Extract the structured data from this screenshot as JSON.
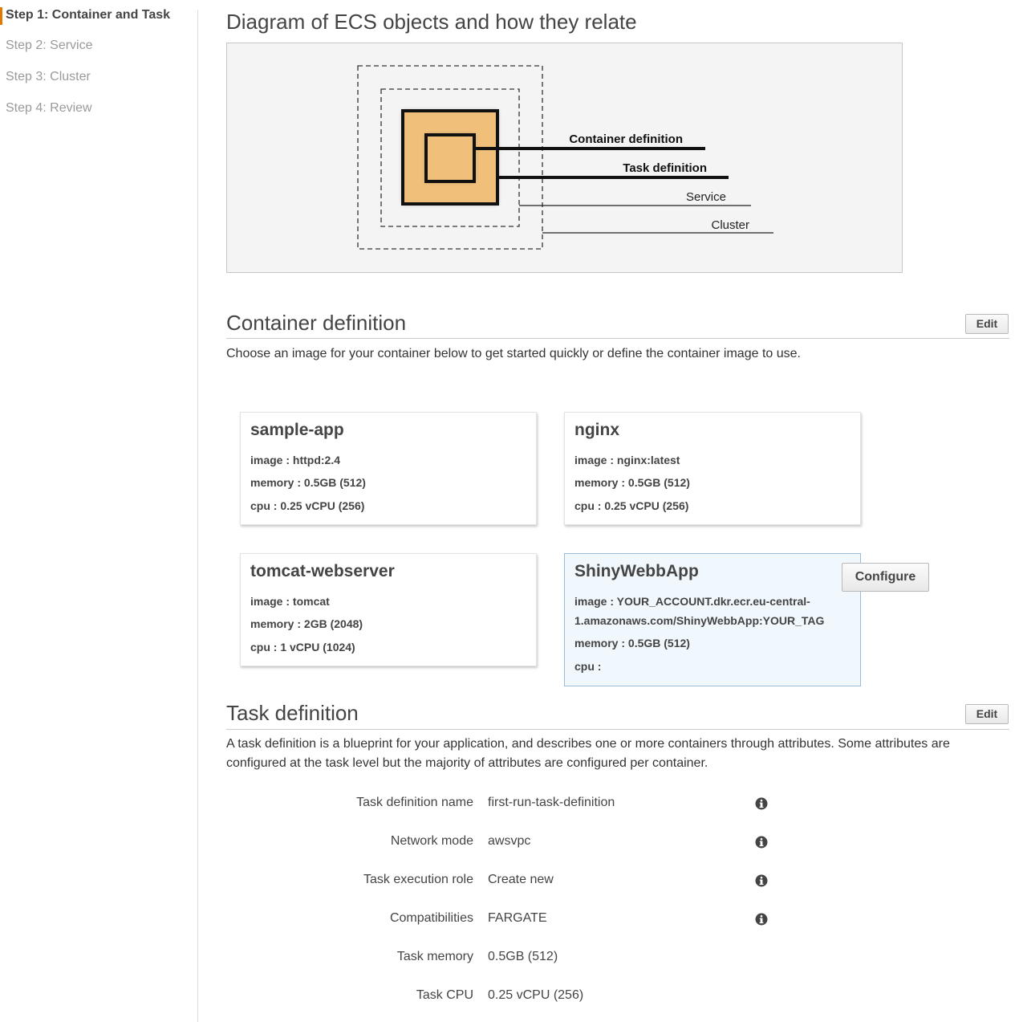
{
  "sidebar": {
    "steps": [
      {
        "label": "Step 1: Container and Task",
        "active": true
      },
      {
        "label": "Step 2: Service",
        "active": false
      },
      {
        "label": "Step 3: Cluster",
        "active": false
      },
      {
        "label": "Step 4: Review",
        "active": false
      }
    ]
  },
  "diagram_section": {
    "title": "Diagram of ECS objects and how they relate",
    "labels": {
      "container_definition": "Container definition",
      "task_definition": "Task definition",
      "service": "Service",
      "cluster": "Cluster"
    },
    "colors": {
      "container_fill": "#f0c07a",
      "background": "#f4f4f4"
    }
  },
  "container_section": {
    "title": "Container definition",
    "edit_label": "Edit",
    "description": "Choose an image for your container below to get started quickly or define the container image to use.",
    "configure_label": "Configure",
    "cards": [
      {
        "name": "sample-app",
        "image": "image : httpd:2.4",
        "memory": "memory :  0.5GB (512)",
        "cpu": "cpu :  0.25 vCPU (256)"
      },
      {
        "name": "nginx",
        "image": "image : nginx:latest",
        "memory": "memory :  0.5GB (512)",
        "cpu": "cpu :  0.25 vCPU (256)"
      },
      {
        "name": "tomcat-webserver",
        "image": "image : tomcat",
        "memory": "memory :  2GB (2048)",
        "cpu": "cpu :  1 vCPU (1024)"
      },
      {
        "name": "ShinyWebbApp",
        "image": "image : YOUR_ACCOUNT.dkr.ecr.eu-central-1.amazonaws.com/ShinyWebbApp:YOUR_TAG",
        "memory": "memory :  0.5GB (512)",
        "cpu": "cpu :",
        "selected": true
      }
    ]
  },
  "task_section": {
    "title": "Task definition",
    "edit_label": "Edit",
    "description": "A task definition is a blueprint for your application, and describes one or more containers through attributes. Some attributes are configured at the task level but the majority of attributes are configured per container.",
    "fields": [
      {
        "label": "Task definition name",
        "value": "first-run-task-definition",
        "info": "info-icon"
      },
      {
        "label": "Network mode",
        "value": "awsvpc",
        "info": "info-icon"
      },
      {
        "label": "Task execution role",
        "value": "Create new",
        "info": "info-icon"
      },
      {
        "label": "Compatibilities",
        "value": "FARGATE",
        "info": "info-icon"
      },
      {
        "label": "Task memory",
        "value": "0.5GB (512)"
      },
      {
        "label": "Task CPU",
        "value": "0.25 vCPU (256)"
      }
    ]
  }
}
